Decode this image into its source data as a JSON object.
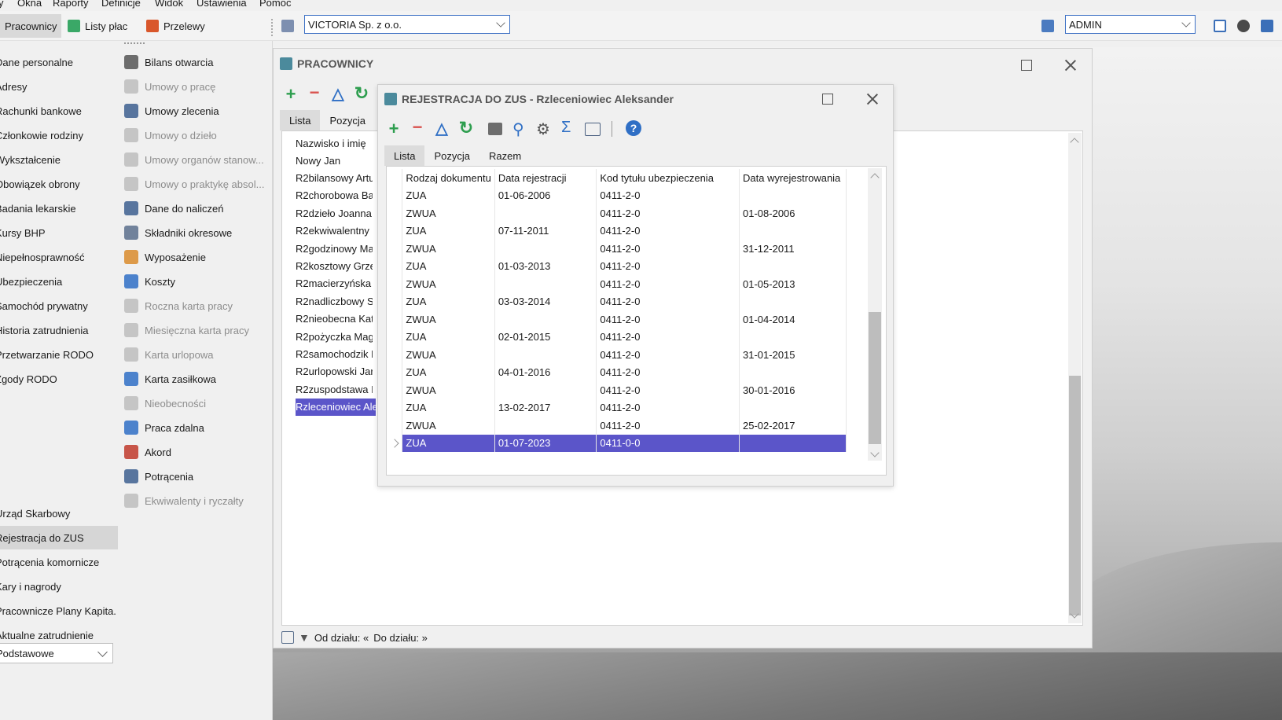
{
  "menu": [
    "y",
    "Okna",
    "Raporty",
    "Definicje",
    "Widok",
    "Ustawienia",
    "Pomoc"
  ],
  "toolbar": {
    "employees": "Pracownicy",
    "payroll": "Listy płac",
    "transfers": "Przelewy",
    "company": "VICTORIA Sp. z o.o.",
    "user": "ADMIN"
  },
  "nav_left": [
    "Dane personalne",
    "Adresy",
    "Rachunki bankowe",
    "Członkowie rodziny",
    "Wykształcenie",
    "Obowiązek obrony",
    "Badania lekarskie",
    "Kursy BHP",
    "Niepełnosprawność",
    "Ubezpieczenia",
    "Samochód prywatny",
    "Historia zatrudnienia",
    "Przetwarzanie RODO",
    "Zgody RODO"
  ],
  "nav_left_bottom": [
    "Urząd Skarbowy",
    "Rejestracja do ZUS",
    "Potrącenia komornicze",
    "Kary i nagrody",
    "Pracownicze Plany Kapita.",
    "Aktualne zatrudnienie"
  ],
  "nav_left_combo": "Podstawowe",
  "nav_right": [
    {
      "label": "Bilans otwarcia",
      "disabled": false
    },
    {
      "label": "Umowy o pracę",
      "disabled": true
    },
    {
      "label": "Umowy zlecenia",
      "disabled": false
    },
    {
      "label": "Umowy o dzieło",
      "disabled": true
    },
    {
      "label": "Umowy organów stanow...",
      "disabled": true
    },
    {
      "label": "Umowy o praktykę absol...",
      "disabled": true
    },
    {
      "label": "Dane do naliczeń",
      "disabled": false
    },
    {
      "label": "Składniki okresowe",
      "disabled": false
    },
    {
      "label": "Wyposażenie",
      "disabled": false
    },
    {
      "label": "Koszty",
      "disabled": false
    },
    {
      "label": "Roczna karta pracy",
      "disabled": true
    },
    {
      "label": "Miesięczna karta pracy",
      "disabled": true
    },
    {
      "label": "Karta urlopowa",
      "disabled": true
    },
    {
      "label": "Karta zasiłkowa",
      "disabled": false
    },
    {
      "label": "Nieobecności",
      "disabled": true
    },
    {
      "label": "Praca zdalna",
      "disabled": false
    },
    {
      "label": "Akord",
      "disabled": false
    },
    {
      "label": "Potrącenia",
      "disabled": false
    },
    {
      "label": "Ekwiwalenty i ryczałty",
      "disabled": true
    }
  ],
  "pracownicy": {
    "title": "PRACOWNICY",
    "tabs": [
      "Lista",
      "Pozycja"
    ],
    "column": "Nazwisko i imię",
    "rows": [
      "Nowy Jan",
      "R2bilansowy Artu",
      "R2chorobowa Ba",
      "R2dzieło Joanna",
      "R2ekwiwalentny",
      "R2godzinowy Ma",
      "R2kosztowy Grze",
      "R2macierzyńska",
      "R2nadliczbowy S",
      "R2nieobecna Kat",
      "R2pożyczka Mag",
      "R2samochodzik D",
      "R2urlopowski Jar",
      "R2zuspodstawa I",
      "Rzleceniowiec Ale"
    ],
    "status_from": "Od działu: «",
    "status_to": "Do działu: »"
  },
  "zus": {
    "title": "REJESTRACJA DO ZUS - Rzleceniowiec Aleksander",
    "tabs": [
      "Lista",
      "Pozycja",
      "Razem"
    ],
    "columns": [
      "Rodzaj dokumentu",
      "Data rejestracji",
      "Kod tytułu ubezpieczenia",
      "Data wyrejestrowania"
    ],
    "rows": [
      [
        "ZUA",
        "01-06-2006",
        "0411-2-0",
        ""
      ],
      [
        "ZWUA",
        "",
        "0411-2-0",
        "01-08-2006"
      ],
      [
        "ZUA",
        "07-11-2011",
        "0411-2-0",
        ""
      ],
      [
        "ZWUA",
        "",
        "0411-2-0",
        "31-12-2011"
      ],
      [
        "ZUA",
        "01-03-2013",
        "0411-2-0",
        ""
      ],
      [
        "ZWUA",
        "",
        "0411-2-0",
        "01-05-2013"
      ],
      [
        "ZUA",
        "03-03-2014",
        "0411-2-0",
        ""
      ],
      [
        "ZWUA",
        "",
        "0411-2-0",
        "01-04-2014"
      ],
      [
        "ZUA",
        "02-01-2015",
        "0411-2-0",
        ""
      ],
      [
        "ZWUA",
        "",
        "0411-2-0",
        "31-01-2015"
      ],
      [
        "ZUA",
        "04-01-2016",
        "0411-2-0",
        ""
      ],
      [
        "ZWUA",
        "",
        "0411-2-0",
        "30-01-2016"
      ],
      [
        "ZUA",
        "13-02-2017",
        "0411-2-0",
        ""
      ],
      [
        "ZWUA",
        "",
        "0411-2-0",
        "25-02-2017"
      ],
      [
        "ZUA",
        "01-07-2023",
        "0411-0-0",
        ""
      ]
    ]
  },
  "colors": {
    "selection": "#5b55c9",
    "accent_green": "#2e9e4f",
    "accent_red": "#d9534f",
    "accent_blue": "#2f6fc5"
  }
}
